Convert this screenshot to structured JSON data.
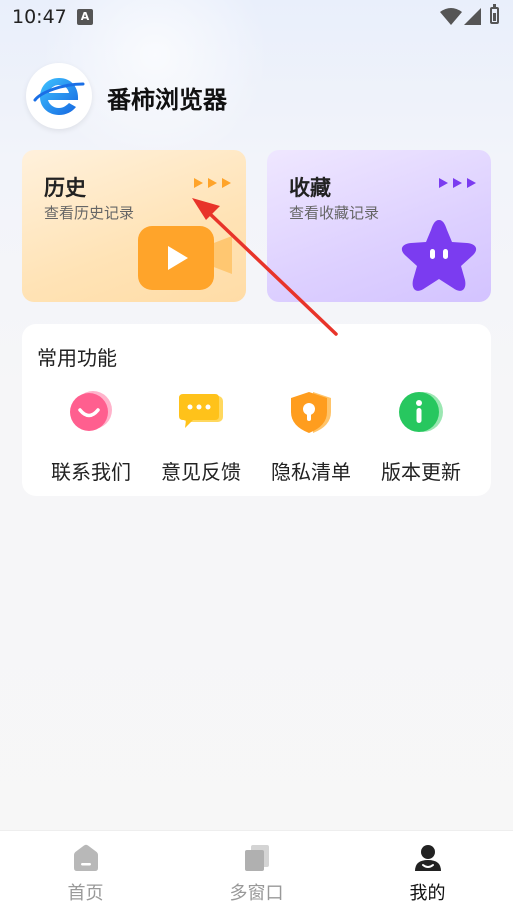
{
  "status_bar": {
    "time": "10:47",
    "notification_icon": "A"
  },
  "header": {
    "app_name": "番柿浏览器",
    "logo_icon": "browser-e-logo"
  },
  "cards": [
    {
      "title": "历史",
      "subtitle": "查看历史记录",
      "icon": "video-play-icon",
      "accent": "#ffa42a"
    },
    {
      "title": "收藏",
      "subtitle": "查看收藏记录",
      "icon": "star-icon",
      "accent": "#7b3cf0"
    }
  ],
  "functions": {
    "title": "常用功能",
    "items": [
      {
        "label": "联系我们",
        "icon": "chat-smile-icon",
        "color": "#ff5f8f"
      },
      {
        "label": "意见反馈",
        "icon": "feedback-icon",
        "color": "#ffc21a"
      },
      {
        "label": "隐私清单",
        "icon": "shield-lock-icon",
        "color": "#ff9d1e"
      },
      {
        "label": "版本更新",
        "icon": "info-icon",
        "color": "#27c75f"
      }
    ]
  },
  "bottom_nav": [
    {
      "label": "首页",
      "icon": "home-icon",
      "active": false
    },
    {
      "label": "多窗口",
      "icon": "windows-icon",
      "active": false
    },
    {
      "label": "我的",
      "icon": "user-icon",
      "active": true
    }
  ],
  "annotation": {
    "color": "#e8342a"
  }
}
